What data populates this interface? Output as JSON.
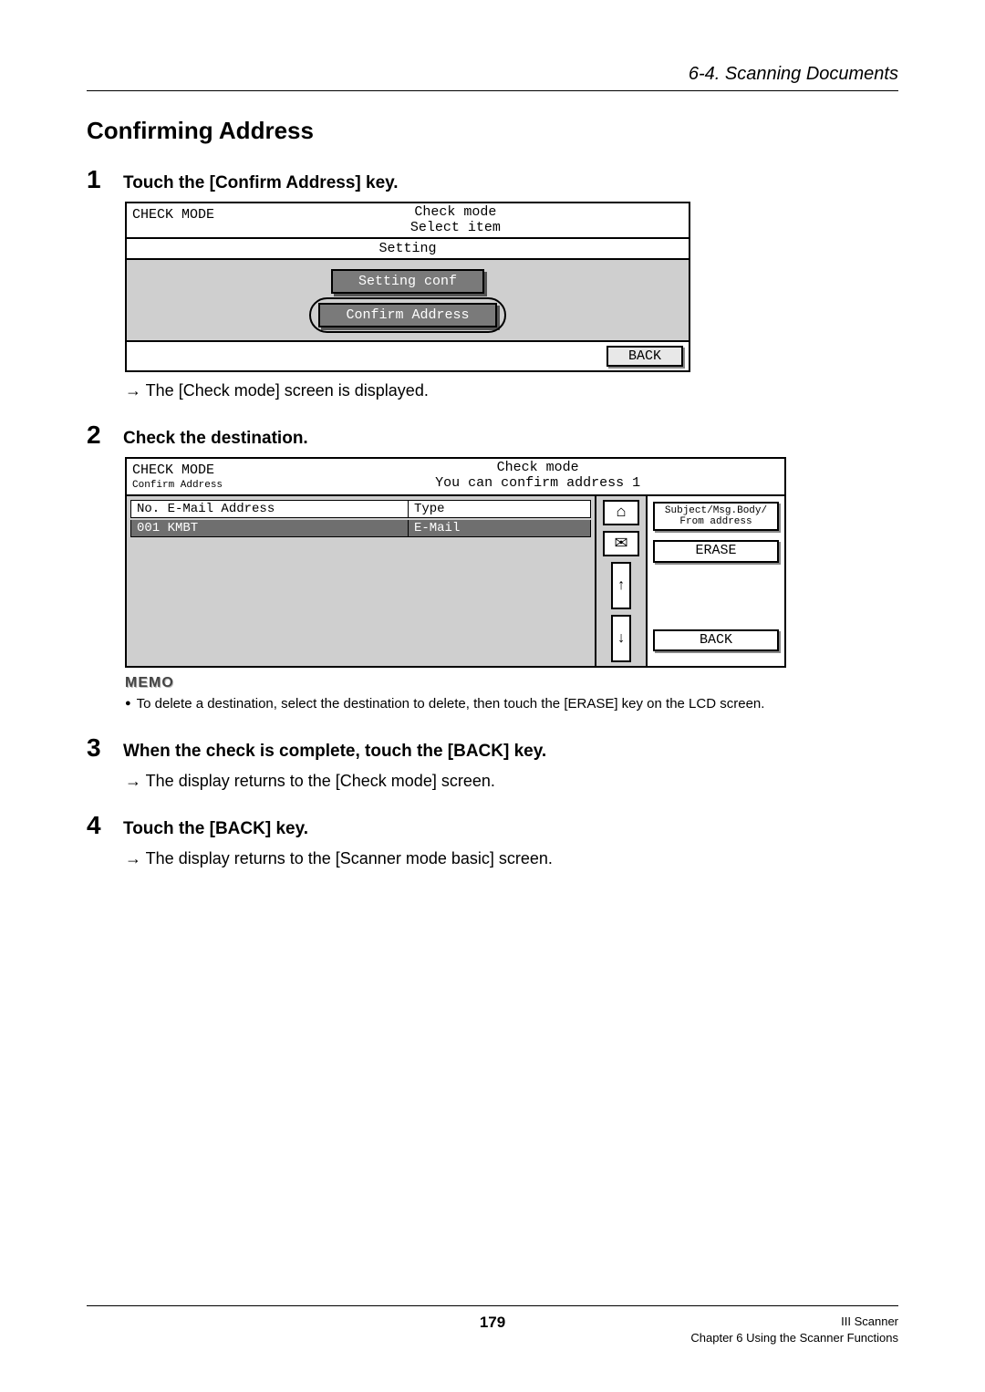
{
  "header": {
    "section_path": "6-4. Scanning Documents"
  },
  "title": "Confirming Address",
  "steps": {
    "s1": {
      "num": "1",
      "text": "Touch the [Confirm Address] key.",
      "result": "→ The [Check mode] screen is displayed."
    },
    "s2": {
      "num": "2",
      "text": "Check the destination."
    },
    "s3": {
      "num": "3",
      "text": "When the check is complete, touch the [BACK] key.",
      "result": "→ The display returns to the [Check mode] screen."
    },
    "s4": {
      "num": "4",
      "text": "Touch the [BACK] key.",
      "result": "→ The display returns to the [Scanner mode basic] screen."
    }
  },
  "panel1": {
    "mode_label": "CHECK MODE",
    "header_line1": "Check mode",
    "header_line2": "Select item",
    "setting_label": "Setting",
    "btn_setting_conf": "Setting conf",
    "btn_confirm_address": "Confirm Address",
    "back": "BACK"
  },
  "panel2": {
    "mode_label": "CHECK MODE",
    "mode_sub": "Confirm Address",
    "header_line1": "Check mode",
    "header_line2": "You can confirm address 1",
    "col1": "No.  E-Mail Address",
    "col2": "Type",
    "row_no": "001  KMBT",
    "row_type": "E-Mail",
    "arrow_up": "↑",
    "arrow_down": "↓",
    "btn_subject": "Subject/Msg.Body/\nFrom address",
    "btn_erase": "ERASE",
    "btn_back": "BACK"
  },
  "memo": {
    "label": "MEMO",
    "text": "To delete a destination, select the destination to delete, then touch the [ERASE] key on the LCD screen."
  },
  "footer": {
    "page": "179",
    "right1": "III Scanner",
    "right2": "Chapter 6 Using the Scanner Functions"
  }
}
